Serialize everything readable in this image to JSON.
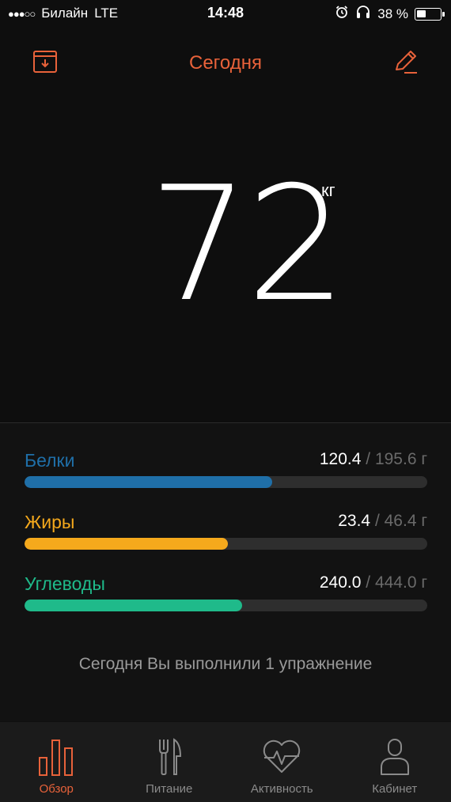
{
  "status_bar": {
    "signal": "●●●○○",
    "carrier": "Билайн",
    "network": "LTE",
    "time": "14:48",
    "battery": "38 %",
    "battery_level": 0.38,
    "icons": [
      "alarm-icon",
      "headphones-icon",
      "battery-icon"
    ]
  },
  "header": {
    "title": "Сегодня",
    "left_icon": "calendar-download-icon",
    "right_icon": "pencil-icon"
  },
  "weight": {
    "value": "72",
    "unit": "кг"
  },
  "macros": [
    {
      "label": "Белки",
      "current": "120.4",
      "sep": " / ",
      "target": "195.6 г",
      "fraction": 0.615,
      "color": "#1f6fa8"
    },
    {
      "label": "Жиры",
      "current": "23.4",
      "sep": " / ",
      "target": "46.4 г",
      "fraction": 0.504,
      "color": "#f5a91c"
    },
    {
      "label": "Углеводы",
      "current": "240.0",
      "sep": " / ",
      "target": "444.0 г",
      "fraction": 0.54,
      "color": "#1fba8a"
    }
  ],
  "exercise_note": "Сегодня Вы выполнили 1 упражнение",
  "tabs": [
    {
      "label": "Обзор",
      "icon": "bar-chart-icon",
      "active": true
    },
    {
      "label": "Питание",
      "icon": "fork-knife-icon",
      "active": false
    },
    {
      "label": "Активность",
      "icon": "heart-pulse-icon",
      "active": false
    },
    {
      "label": "Кабинет",
      "icon": "user-icon",
      "active": false
    }
  ],
  "colors": {
    "accent": "#e8623a",
    "protein": "#1f6fa8",
    "fat": "#f5a91c",
    "carbs": "#1fba8a"
  }
}
